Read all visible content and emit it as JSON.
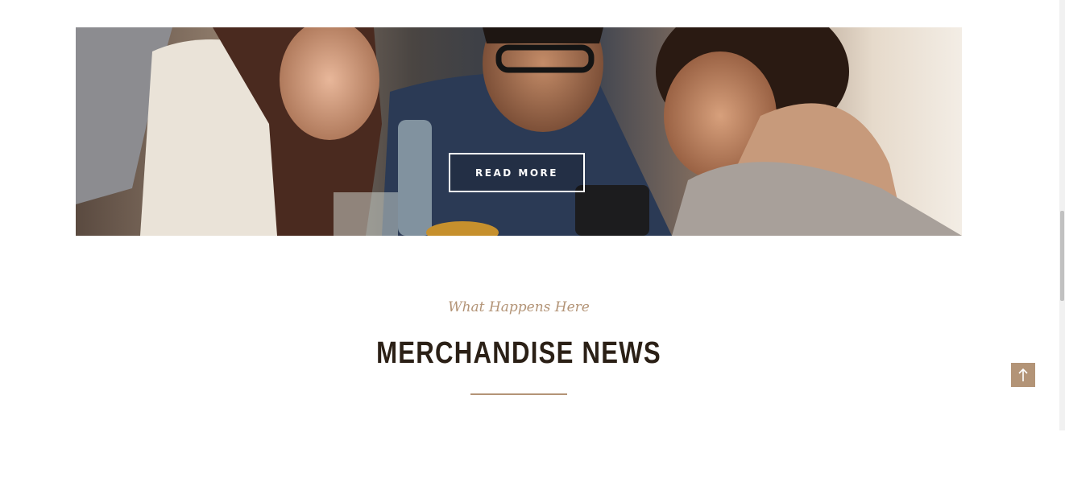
{
  "hero": {
    "image_alt": "Friends laughing at a cafe table",
    "read_more_label": "READ MORE"
  },
  "section": {
    "subtitle": "What Happens Here",
    "title": "MERCHANDISE NEWS"
  },
  "back_to_top": {
    "icon": "arrow-up-icon"
  },
  "colors": {
    "accent": "#b39477",
    "title": "#2b2016",
    "background": "#ffffff"
  }
}
